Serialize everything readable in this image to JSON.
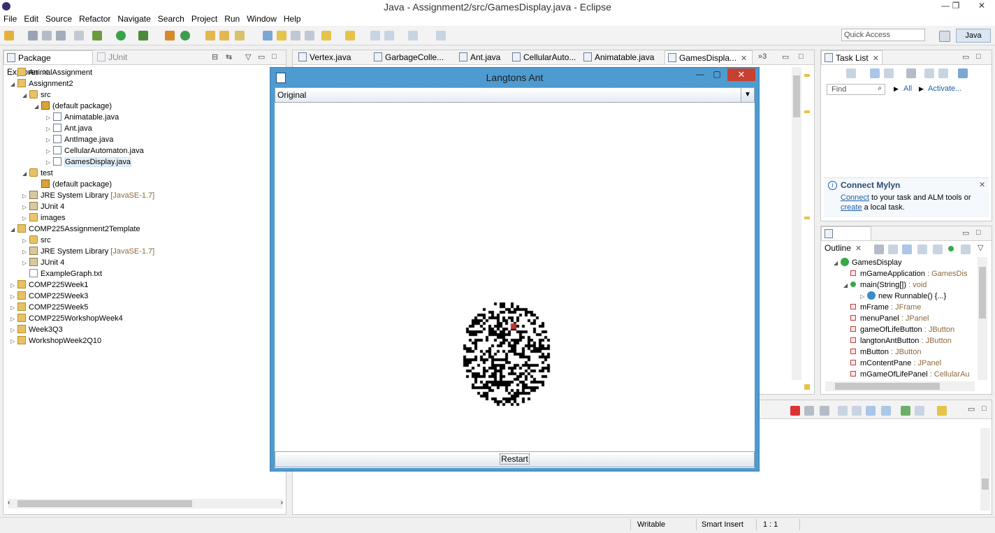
{
  "window": {
    "title": "Java - Assignment2/src/GamesDisplay.java - Eclipse",
    "minimize": "—",
    "maximize": "❐",
    "close": "✕"
  },
  "menu": [
    "File",
    "Edit",
    "Source",
    "Refactor",
    "Navigate",
    "Search",
    "Project",
    "Run",
    "Window",
    "Help"
  ],
  "toolbar": {
    "quick_access": "Quick Access",
    "perspective": "Java"
  },
  "package_explorer": {
    "tab_label": "Package Explorer",
    "junit_tab_label": "JUnit",
    "items": [
      {
        "label": "AnimalAssignment"
      },
      {
        "label": "Assignment2"
      },
      {
        "label": "src"
      },
      {
        "label": "(default package)"
      },
      {
        "label": "Animatable.java"
      },
      {
        "label": "Ant.java"
      },
      {
        "label": "AntImage.java"
      },
      {
        "label": "CellularAutomaton.java"
      },
      {
        "label": "GamesDisplay.java"
      },
      {
        "label": "test"
      },
      {
        "label": "(default package)"
      },
      {
        "label": "JRE System Library",
        "suffix": "[JavaSE-1.7]"
      },
      {
        "label": "JUnit 4"
      },
      {
        "label": "images"
      },
      {
        "label": "COMP225Assignment2Template"
      },
      {
        "label": "src"
      },
      {
        "label": "JRE System Library",
        "suffix": "[JavaSE-1.7]"
      },
      {
        "label": "JUnit 4"
      },
      {
        "label": "ExampleGraph.txt"
      },
      {
        "label": "COMP225Week1"
      },
      {
        "label": "COMP225Week3"
      },
      {
        "label": "COMP225Week5"
      },
      {
        "label": "COMP225WorkshopWeek4"
      },
      {
        "label": "Week3Q3"
      },
      {
        "label": "WorkshopWeek2Q10"
      }
    ]
  },
  "editor_tabs": [
    "Vertex.java",
    "GarbageColle...",
    "Ant.java",
    "CellularAuto...",
    "Animatable.java",
    "GamesDispla..."
  ],
  "editor_overflow": "»3",
  "task_list": {
    "tab_label": "Task List",
    "find_placeholder": "Find",
    "all_label": "All",
    "activate_label": "Activate..."
  },
  "mylyn": {
    "title": "Connect Mylyn",
    "connect_link": "Connect",
    "line1_rest": " to your task and ALM tools or",
    "create_link": "create",
    "line2_rest": " a local task."
  },
  "outline": {
    "tab_label": "Outline",
    "class_name": "GamesDisplay",
    "members": [
      {
        "name": "mGameApplication",
        "type": " : GamesDis",
        "kind": "priv"
      },
      {
        "name": "main(String[])",
        "type": " : void",
        "kind": "pub"
      },
      {
        "name": "new Runnable() {...}",
        "type": "",
        "kind": "anon"
      },
      {
        "name": "mFrame",
        "type": " : JFrame",
        "kind": "priv"
      },
      {
        "name": "menuPanel",
        "type": " : JPanel",
        "kind": "priv"
      },
      {
        "name": "gameOfLifeButton",
        "type": " : JButton",
        "kind": "priv"
      },
      {
        "name": "langtonAntButton",
        "type": " : JButton",
        "kind": "priv"
      },
      {
        "name": "mButton",
        "type": " : JButton",
        "kind": "priv"
      },
      {
        "name": "mContentPane",
        "type": " : JPanel",
        "kind": "priv"
      },
      {
        "name": "mGameOfLifePanel",
        "type": " : CellularAu",
        "kind": "priv"
      }
    ]
  },
  "dialog": {
    "title": "Langtons Ant",
    "combo_selected": "Original",
    "restart_label": "Restart",
    "grid_seed": 7,
    "ant_color": "#c0392b"
  },
  "statusbar": {
    "writable": "Writable",
    "insert_mode": "Smart Insert",
    "position": "1 : 1"
  },
  "colors": {
    "dialog_frame": "#4e9bd1",
    "close_button": "#c8402f",
    "link": "#1f5fa8"
  }
}
